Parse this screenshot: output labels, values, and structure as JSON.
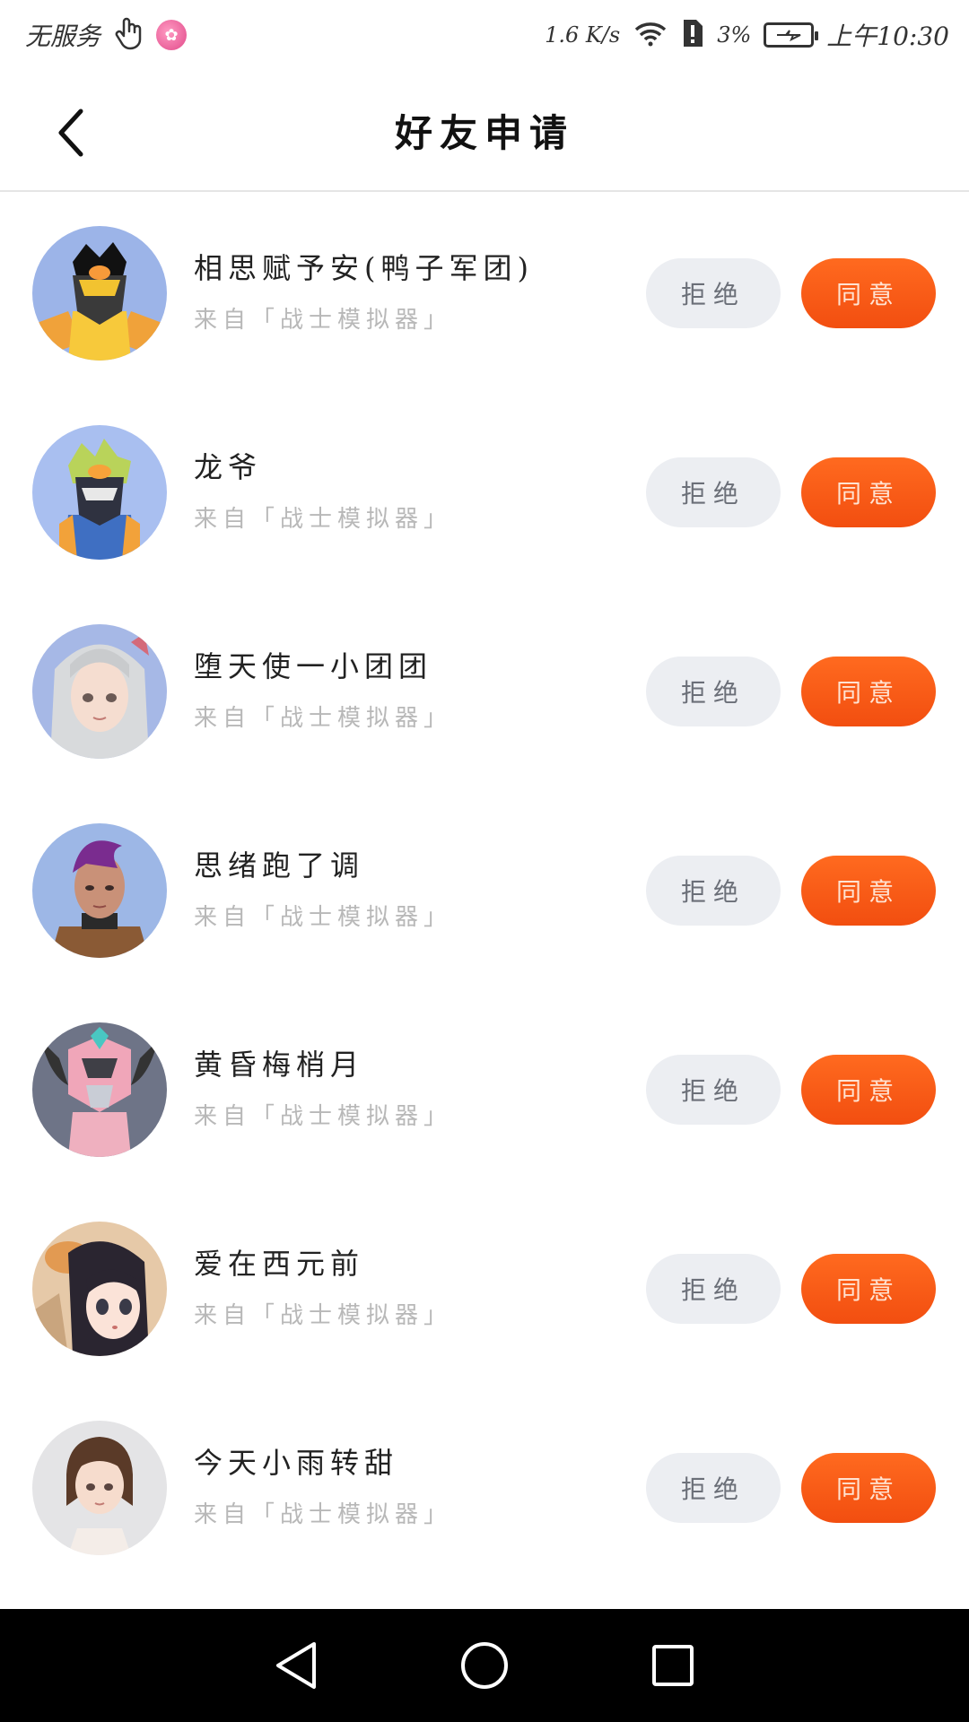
{
  "status_bar": {
    "left_text": "无服务",
    "speed": "1.6 K/s",
    "battery": "3%",
    "time": "上午10:30"
  },
  "header": {
    "title": "好友申请"
  },
  "requests": [
    {
      "name": "相思赋予安(鸭子军团)",
      "source": "来自「战士模拟器」",
      "reject_label": "拒绝",
      "accept_label": "同意"
    },
    {
      "name": "龙爷",
      "source": "来自「战士模拟器」",
      "reject_label": "拒绝",
      "accept_label": "同意"
    },
    {
      "name": "堕天使一小团团",
      "source": "来自「战士模拟器」",
      "reject_label": "拒绝",
      "accept_label": "同意"
    },
    {
      "name": "思绪跑了调",
      "source": "来自「战士模拟器」",
      "reject_label": "拒绝",
      "accept_label": "同意"
    },
    {
      "name": "黄昏梅梢月",
      "source": "来自「战士模拟器」",
      "reject_label": "拒绝",
      "accept_label": "同意"
    },
    {
      "name": "爱在西元前",
      "source": "来自「战士模拟器」",
      "reject_label": "拒绝",
      "accept_label": "同意"
    },
    {
      "name": "今天小雨转甜",
      "source": "来自「战士模拟器」",
      "reject_label": "拒绝",
      "accept_label": "同意"
    }
  ],
  "colors": {
    "accept": "#f55a14",
    "reject_bg": "#eceef2"
  }
}
